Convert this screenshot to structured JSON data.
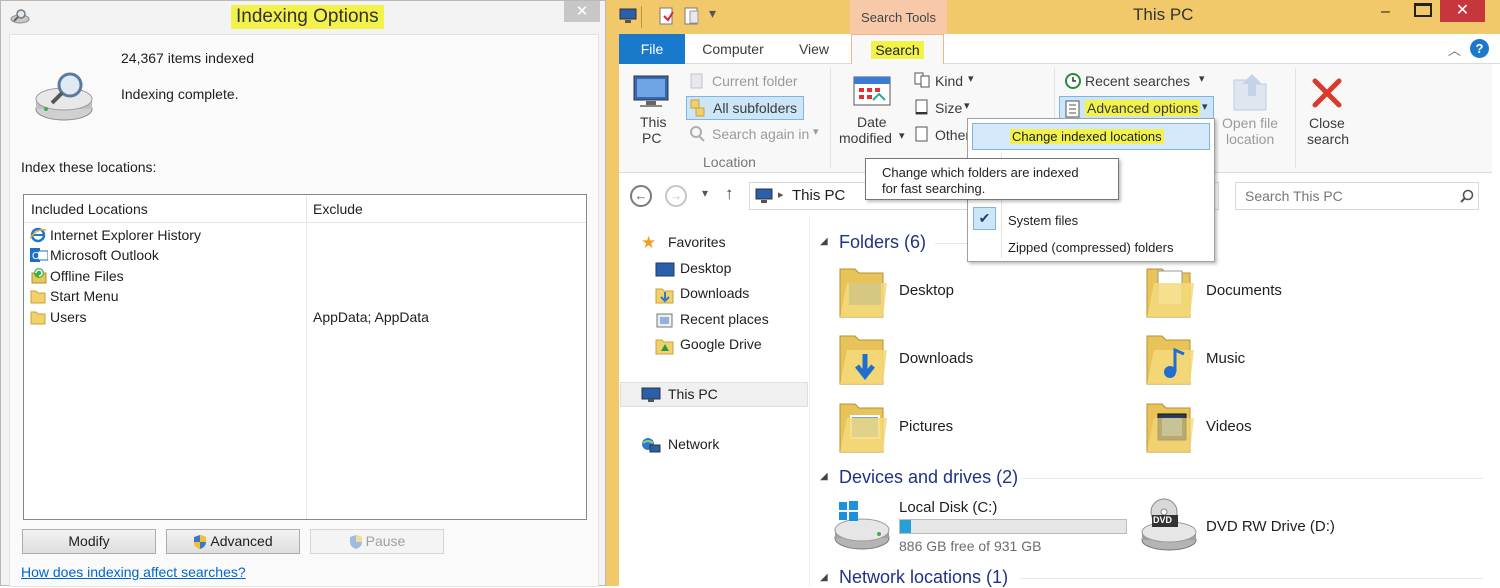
{
  "indexing": {
    "title": "Indexing Options",
    "items_indexed": "24,367 items indexed",
    "status": "Indexing complete.",
    "locations_label": "Index these locations:",
    "headers": {
      "included": "Included Locations",
      "exclude": "Exclude"
    },
    "rows": [
      {
        "name": "Internet Explorer History",
        "exclude": "",
        "icon": "internet-explorer-icon"
      },
      {
        "name": "Microsoft Outlook",
        "exclude": "",
        "icon": "outlook-icon"
      },
      {
        "name": "Offline Files",
        "exclude": "",
        "icon": "offline-files-icon"
      },
      {
        "name": "Start Menu",
        "exclude": "",
        "icon": "folder-icon"
      },
      {
        "name": "Users",
        "exclude": "AppData; AppData",
        "icon": "folder-icon"
      }
    ],
    "buttons": {
      "modify": "Modify",
      "advanced": "Advanced",
      "pause": "Pause"
    },
    "help_link": "How does indexing affect searches?"
  },
  "explorer": {
    "title": "This PC",
    "context_tab": "Search Tools",
    "tabs": {
      "file": "File",
      "computer": "Computer",
      "view": "View",
      "search": "Search"
    },
    "ribbon": {
      "this_pc": [
        "This",
        "PC"
      ],
      "current_folder": "Current folder",
      "all_subfolders": "All subfolders",
      "search_again": "Search again in",
      "location_group": "Location",
      "date_modified": [
        "Date",
        "modified"
      ],
      "kind": "Kind",
      "size": "Size",
      "other": "Other",
      "recent_searches": "Recent searches",
      "advanced_options": "Advanced options",
      "open_file_location": [
        "Open file",
        "location"
      ],
      "close_search": [
        "Close",
        "search"
      ],
      "options_group_tail": "ns"
    },
    "dropdown": {
      "change_indexed": "Change indexed locations",
      "system_files": "System files",
      "zipped": "Zipped (compressed) folders"
    },
    "tooltip": [
      "Change which folders are indexed",
      "for fast searching."
    ],
    "address": "This PC",
    "search_placeholder": "Search This PC",
    "nav": {
      "favorites": "Favorites",
      "fav_items": [
        "Desktop",
        "Downloads",
        "Recent places",
        "Google Drive"
      ],
      "this_pc": "This PC",
      "network": "Network"
    },
    "groups": {
      "folders": "Folders (6)",
      "devices": "Devices and drives (2)",
      "network": "Network locations (1)"
    },
    "folders": [
      "Desktop",
      "Documents",
      "Downloads",
      "Music",
      "Pictures",
      "Videos"
    ],
    "drives": {
      "c_name": "Local Disk (C:)",
      "c_free": "886 GB free of 931 GB",
      "c_used_fraction": 0.048,
      "d_name": "DVD RW Drive (D:)",
      "dvd_label": "DVD"
    }
  },
  "colors": {
    "highlight": "#f2f24a",
    "title_bar": "#f2c96a",
    "file_tab": "#1979ca",
    "link": "#0066cc"
  }
}
